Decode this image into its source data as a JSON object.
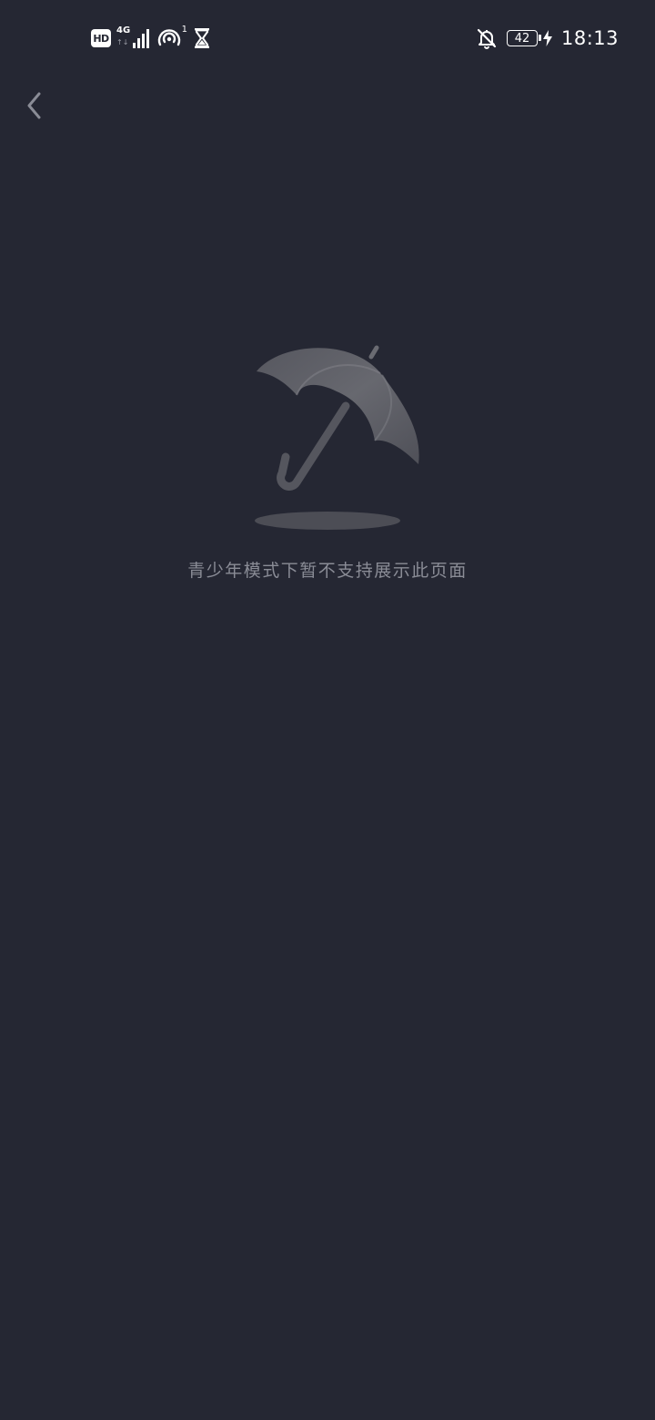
{
  "status_bar": {
    "hd_label": "HD",
    "network_type": "4G",
    "network_arrows": "↑↓",
    "hotspot_count": "1",
    "battery_level": "42",
    "time": "18:13"
  },
  "icons": {
    "back": "chevron-left-icon",
    "hourglass": "hourglass-icon",
    "bell_off": "bell-off-icon",
    "charging": "lightning-icon",
    "signal": "signal-bars-icon",
    "hotspot": "hotspot-icon",
    "empty_state": "umbrella-icon"
  },
  "empty_state": {
    "message": "青少年模式下暂不支持展示此页面"
  },
  "colors": {
    "background": "#252733",
    "message_text": "#8a8c96",
    "umbrella": "#5d5e66"
  }
}
